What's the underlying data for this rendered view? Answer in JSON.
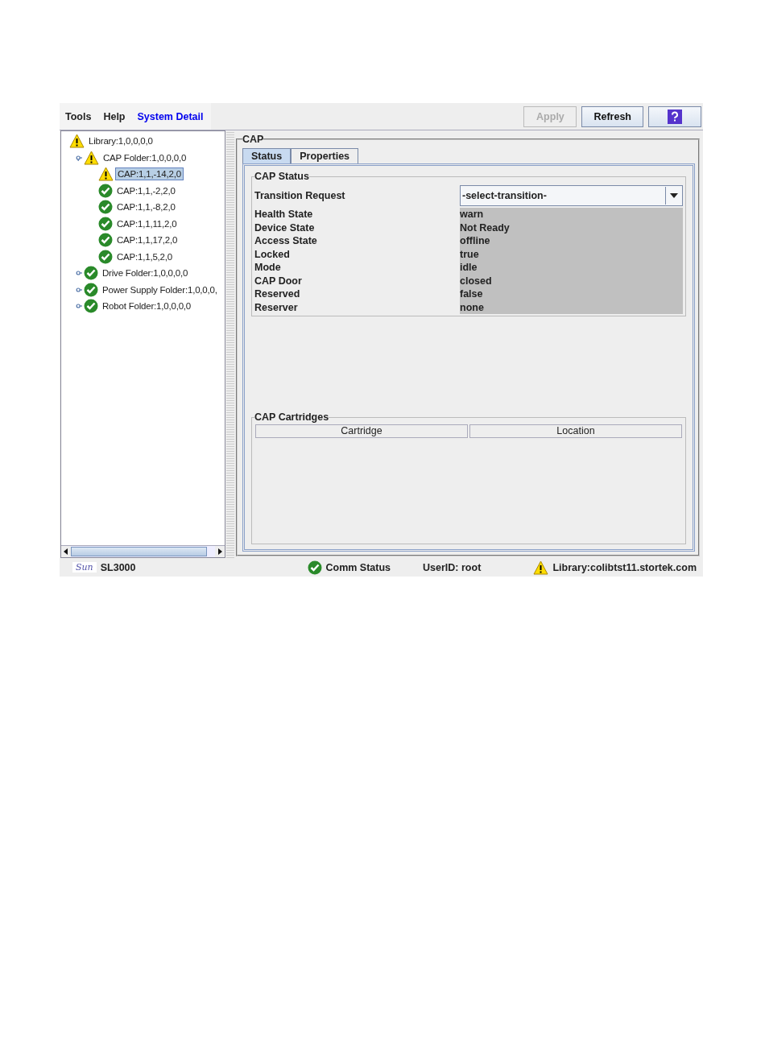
{
  "menu": [
    {
      "label": "Tools",
      "selected": false
    },
    {
      "label": "Help",
      "selected": false
    },
    {
      "label": "System Detail",
      "selected": true
    }
  ],
  "toolbar": {
    "buttons": [
      {
        "label": "Apply",
        "disabled": true
      },
      {
        "label": "Refresh",
        "disabled": false
      }
    ]
  },
  "tree": [
    {
      "label": "Library:1,0,0,0,0",
      "kind": "warn",
      "selected": false,
      "children": [
        {
          "label": "CAP Folder:1,0,0,0,0",
          "kind": "warn",
          "selected": false,
          "expanded": true,
          "children": [
            {
              "label": "CAP:1,1,-14,2,0",
              "kind": "warn",
              "selected": true
            },
            {
              "label": "CAP:1,1,-2,2,0",
              "kind": "ok",
              "selected": false
            },
            {
              "label": "CAP:1,1,-8,2,0",
              "kind": "ok",
              "selected": false
            },
            {
              "label": "CAP:1,1,11,2,0",
              "kind": "ok",
              "selected": false
            },
            {
              "label": "CAP:1,1,17,2,0",
              "kind": "ok",
              "selected": false
            },
            {
              "label": "CAP:1,1,5,2,0",
              "kind": "ok",
              "selected": false
            }
          ]
        },
        {
          "label": "Drive Folder:1,0,0,0,0",
          "kind": "ok",
          "selected": false,
          "expanded": false
        },
        {
          "label": "Power Supply Folder:1,0,0,0,",
          "kind": "ok",
          "selected": false,
          "expanded": false
        },
        {
          "label": "Robot Folder:1,0,0,0,0",
          "kind": "ok",
          "selected": false,
          "expanded": false
        }
      ]
    }
  ],
  "panel": {
    "title": "CAP",
    "tabs": [
      {
        "label": "Status",
        "selected": true
      },
      {
        "label": "Properties",
        "selected": false
      }
    ],
    "status_group": {
      "title": "CAP Status",
      "transition": {
        "label": "Transition Request",
        "value": "-select-transition-"
      },
      "rows": [
        {
          "label": "Health State",
          "value": "warn"
        },
        {
          "label": "Device State",
          "value": "Not Ready"
        },
        {
          "label": "Access State",
          "value": "offline"
        },
        {
          "label": "Locked",
          "value": "true"
        },
        {
          "label": "Mode",
          "value": "idle"
        },
        {
          "label": "CAP Door",
          "value": "closed"
        },
        {
          "label": "Reserved",
          "value": "false"
        },
        {
          "label": "Reserver",
          "value": "none"
        }
      ]
    },
    "cartridges": {
      "title": "CAP Cartridges",
      "columns": [
        "Cartridge",
        "Location"
      ]
    }
  },
  "status_bar": {
    "logo": "Sun",
    "product": "SL3000",
    "comm": {
      "label": "Comm Status",
      "kind": "ok"
    },
    "user": "UserID: root",
    "library": {
      "label": "Library:colibtst11.stortek.com",
      "kind": "warn"
    }
  }
}
